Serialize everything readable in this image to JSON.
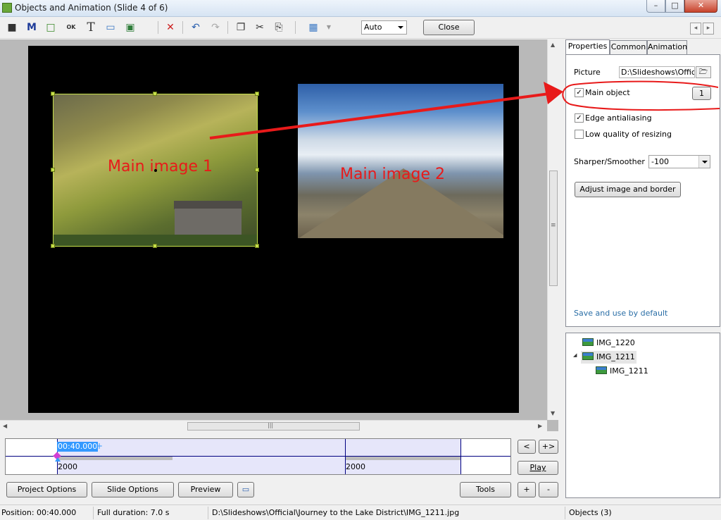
{
  "window": {
    "title": "Objects and Animation  (Slide 4 of 6)",
    "minimize_glyph": "–",
    "maximize_glyph": "□",
    "close_glyph": "✕"
  },
  "toolbar": {
    "icons": [
      "camera-icon",
      "mask-icon",
      "frame-icon",
      "ok-button-icon",
      "text-icon",
      "rectangle-icon",
      "image-icon",
      "delete-icon",
      "undo-icon",
      "redo-icon",
      "copy-icon",
      "cut-icon",
      "paste-icon",
      "grid-icon"
    ],
    "glyphs": {
      "camera": "■",
      "mask": "M",
      "frame": "□",
      "ok": "OK",
      "text": "T",
      "rectangle": "▭",
      "image": "▣",
      "delete": "✕",
      "undo": "↶",
      "redo": "↷",
      "copy": "❐",
      "cut": "✂",
      "paste": "⎘",
      "grid": "▦"
    },
    "zoom_value": "Auto",
    "close_label": "Close",
    "nav_prev": "◂",
    "nav_next": "▸"
  },
  "canvas": {
    "image1_label": "Main image 1",
    "image2_label": "Main image 2",
    "scroll_up": "▲",
    "scroll_down": "▼",
    "scroll_left": "◀",
    "scroll_right": "▶",
    "grip": "≡",
    "hgrip": "|||"
  },
  "colors": {
    "annotation_red": "#e81a1a",
    "selection_green": "#c6e04a",
    "link_blue": "#2a6ea6"
  },
  "properties_panel": {
    "tabs": [
      {
        "label": "Properties",
        "active": true
      },
      {
        "label": "Common",
        "active": false
      },
      {
        "label": "Animation",
        "active": false
      }
    ],
    "picture_label": "Picture",
    "picture_value": "D:\\Slideshows\\Official",
    "browse_glyph": "🗁",
    "main_object_label": "Main object",
    "main_object_checked": true,
    "main_object_number": "1",
    "edge_antialiasing_label": "Edge antialiasing",
    "edge_antialiasing_checked": true,
    "low_quality_label": "Low quality of resizing",
    "low_quality_checked": false,
    "check_glyph": "✓",
    "sharper_label": "Sharper/Smoother",
    "sharper_value": "-100",
    "adjust_button": "Adjust image and border",
    "save_default": "Save and use by default"
  },
  "objects_tree": {
    "items": [
      {
        "label": "IMG_1220",
        "level": 0
      },
      {
        "label": "IMG_1211",
        "level": 0,
        "expanded": true,
        "selected": true
      },
      {
        "label": "IMG_1211",
        "level": 1
      }
    ],
    "expand_glyph": "◢"
  },
  "timeline": {
    "time": "00:40.000",
    "plus": "+",
    "value_left": "2000",
    "value_right": "2000",
    "btn_prev": "<",
    "btn_add_next": "+>",
    "btn_play": "Play",
    "btn_plus": "+",
    "btn_minus": "-"
  },
  "bottom_buttons": {
    "project_options": "Project Options",
    "slide_options": "Slide Options",
    "preview": "Preview",
    "tools": "Tools",
    "screen_glyph": "▭"
  },
  "status": {
    "position": "Position:  00:40.000",
    "duration": "Full duration:  7.0 s",
    "path": "D:\\Slideshows\\Official\\Journey to the Lake District\\IMG_1211.jpg",
    "objects": "Objects (3)"
  }
}
